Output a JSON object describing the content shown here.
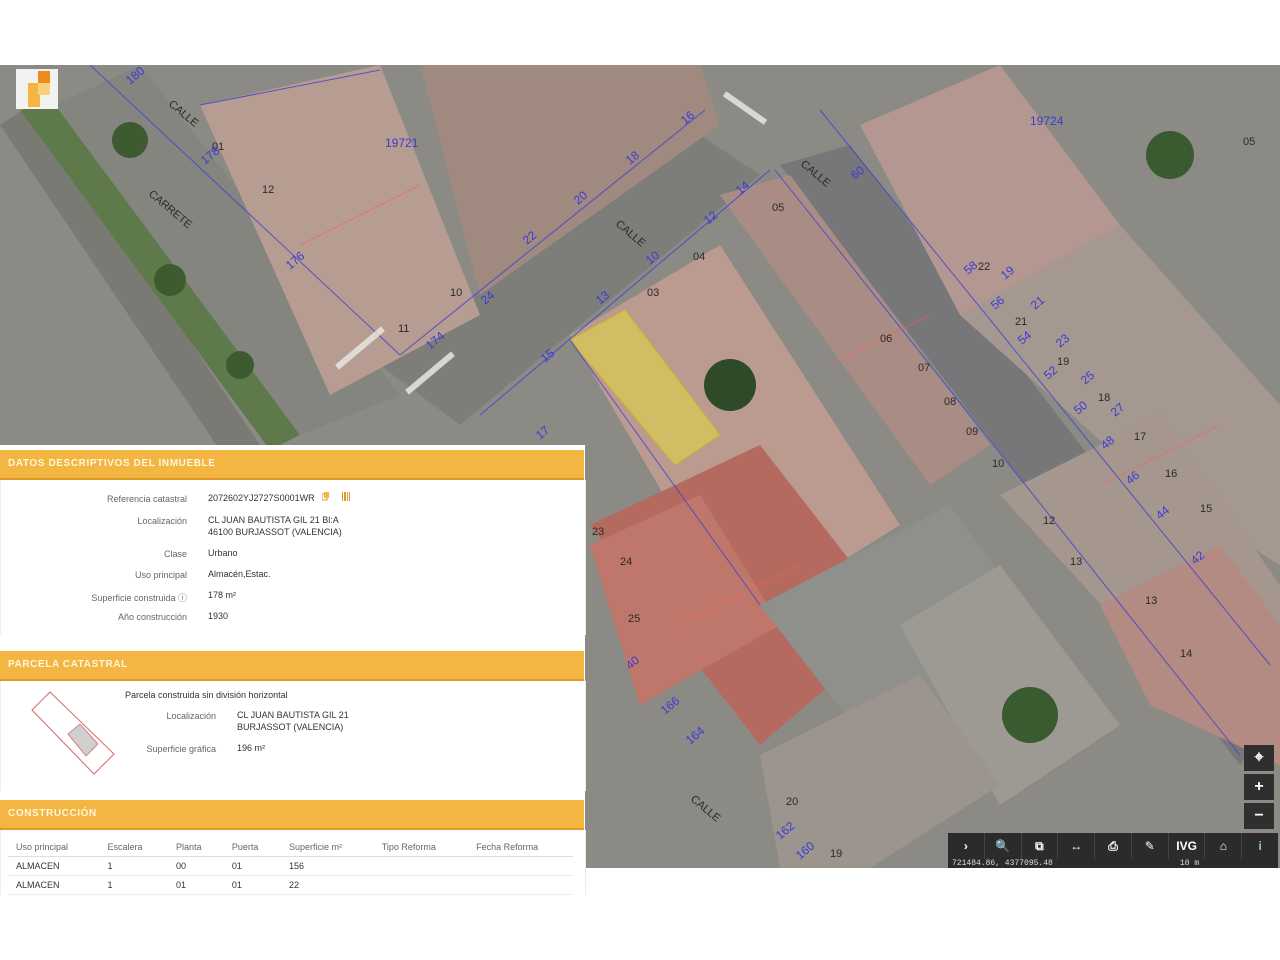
{
  "map": {
    "parcel_numbers": [
      "01",
      "12",
      "11",
      "10",
      "03",
      "05",
      "06",
      "07",
      "08",
      "09",
      "10",
      "12",
      "13",
      "13",
      "14",
      "15",
      "16",
      "17",
      "18",
      "19",
      "20",
      "19",
      "22",
      "21",
      "04",
      "05",
      "25",
      "24",
      "23"
    ],
    "street_numbers": [
      "180",
      "178",
      "176",
      "174",
      "24",
      "22",
      "20",
      "18",
      "16",
      "14",
      "12",
      "10",
      "13",
      "15",
      "17",
      "19",
      "21",
      "23",
      "25",
      "27",
      "60",
      "58",
      "56",
      "54",
      "52",
      "50",
      "48",
      "46",
      "44",
      "42",
      "40",
      "166",
      "164",
      "162",
      "160"
    ],
    "street_labels": [
      "CALLE",
      "CALLE",
      "CARRETE",
      "CALLE",
      "CALLE"
    ],
    "block_ids": [
      "19724",
      "19721"
    ],
    "controls": {
      "locate": "⌖",
      "zoom_in": "+",
      "zoom_out": "−"
    },
    "toolbar": [
      "›",
      "🔍",
      "⧉",
      "↔",
      "⎙",
      "✎",
      "IVG",
      "⌂",
      "i"
    ],
    "scale_text": "10 m",
    "coord_text": "721484.86, 4377095.48"
  },
  "datos": {
    "title": "DATOS DESCRIPTIVOS DEL INMUEBLE",
    "ref_label": "Referencia catastral",
    "ref_value": "2072602YJ2727S0001WR",
    "loc_label": "Localización",
    "loc_line1": "CL JUAN BAUTISTA GIL 21 Bl:A",
    "loc_line2": "46100 BURJASSOT (VALENCIA)",
    "clase_label": "Clase",
    "clase_value": "Urbano",
    "uso_label": "Uso principal",
    "uso_value": "Almacén,Estac.",
    "sup_label": "Superficie construida",
    "sup_value": "178 m²",
    "anio_label": "Año construcción",
    "anio_value": "1930"
  },
  "parcela": {
    "title": "PARCELA CATASTRAL",
    "subtitle": "Parcela construida sin división horizontal",
    "loc_label": "Localización",
    "loc_line1": "CL JUAN BAUTISTA GIL 21",
    "loc_line2": "BURJASSOT (VALENCIA)",
    "sup_label": "Superficie gráfica",
    "sup_value": "196 m²"
  },
  "construccion": {
    "title": "CONSTRUCCIÓN",
    "headers": [
      "Uso principal",
      "Escalera",
      "Planta",
      "Puerta",
      "Superficie m²",
      "Tipo Reforma",
      "Fecha Reforma"
    ],
    "rows": [
      [
        "ALMACEN",
        "1",
        "00",
        "01",
        "156",
        "",
        ""
      ],
      [
        "ALMACEN",
        "1",
        "01",
        "01",
        "22",
        "",
        ""
      ]
    ]
  },
  "colors": {
    "accent": "#f3b642",
    "highlight": "#e6d840"
  }
}
